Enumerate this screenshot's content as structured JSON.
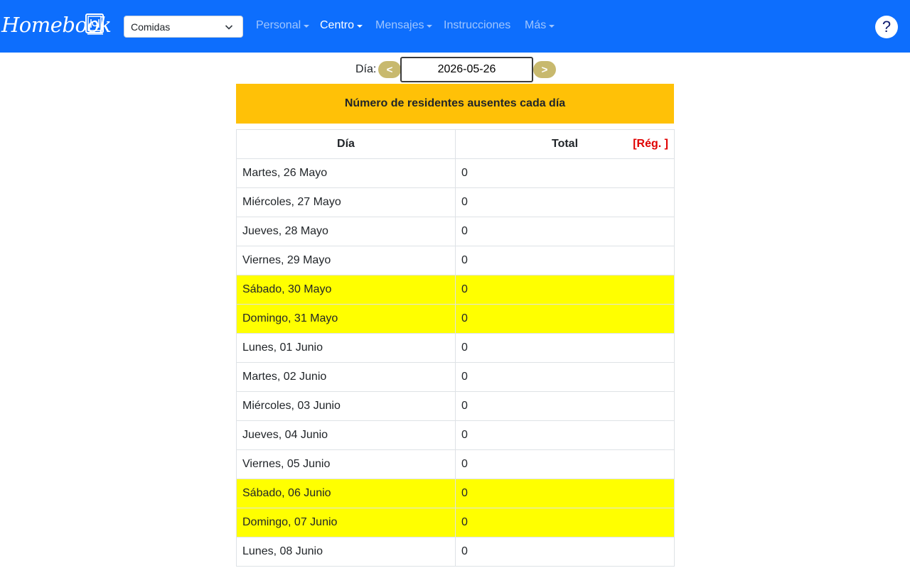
{
  "navbar": {
    "brand": "Homebook",
    "select_value": "Comidas",
    "items": [
      {
        "label": "Personal",
        "dropdown": true,
        "active": false
      },
      {
        "label": "Centro",
        "dropdown": true,
        "active": true
      },
      {
        "label": "Mensajes",
        "dropdown": true,
        "active": false
      },
      {
        "label": "Instrucciones",
        "dropdown": false,
        "active": false
      },
      {
        "label": "Más",
        "dropdown": true,
        "active": false
      }
    ],
    "help_label": "?"
  },
  "day_picker": {
    "label": "Día:",
    "prev_label": "<",
    "next_label": ">",
    "date_value": "2026-05-26"
  },
  "banner": {
    "title": "Número de residentes ausentes cada día"
  },
  "table": {
    "headers": {
      "day": "Día",
      "total": "Total",
      "reg_link": "[Rég. ]"
    },
    "rows": [
      {
        "day": "Martes, 26 Mayo",
        "total": "0",
        "weekend": false
      },
      {
        "day": "Miércoles, 27 Mayo",
        "total": "0",
        "weekend": false
      },
      {
        "day": "Jueves, 28 Mayo",
        "total": "0",
        "weekend": false
      },
      {
        "day": "Viernes, 29 Mayo",
        "total": "0",
        "weekend": false
      },
      {
        "day": "Sábado, 30 Mayo",
        "total": "0",
        "weekend": true
      },
      {
        "day": "Domingo, 31 Mayo",
        "total": "0",
        "weekend": true
      },
      {
        "day": "Lunes, 01 Junio",
        "total": "0",
        "weekend": false
      },
      {
        "day": "Martes, 02 Junio",
        "total": "0",
        "weekend": false
      },
      {
        "day": "Miércoles, 03 Junio",
        "total": "0",
        "weekend": false
      },
      {
        "day": "Jueves, 04 Junio",
        "total": "0",
        "weekend": false
      },
      {
        "day": "Viernes, 05 Junio",
        "total": "0",
        "weekend": false
      },
      {
        "day": "Sábado, 06 Junio",
        "total": "0",
        "weekend": true
      },
      {
        "day": "Domingo, 07 Junio",
        "total": "0",
        "weekend": true
      },
      {
        "day": "Lunes, 08 Junio",
        "total": "0",
        "weekend": false
      }
    ]
  },
  "colors": {
    "navbar": "#0d6efd",
    "banner": "#ffc107",
    "weekend_row": "#ffff00",
    "nav_button": "#c8b96e",
    "reg_link": "#e00000"
  }
}
